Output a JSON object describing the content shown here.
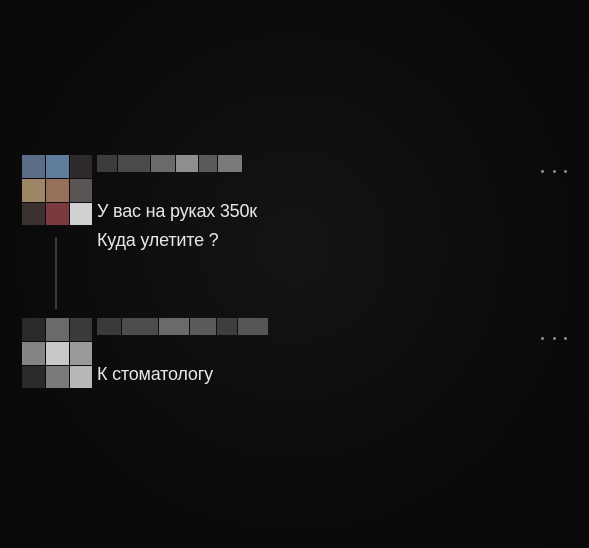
{
  "thread": {
    "posts": [
      {
        "lines": [
          "У вас на руках 350к",
          "Куда улетите ?"
        ],
        "avatar_colors": [
          "#5a6c86",
          "#5f7c9c",
          "#2e2a2c",
          "#9d8666",
          "#96705a",
          "#5a5454",
          "#3a3030",
          "#7a3a40",
          "#cfd1d3"
        ],
        "username_colors": [
          "#3c3c3c",
          "#4a4a4a",
          "#6a6a6a",
          "#8e8e8e",
          "#5a5a5a",
          "#7a7a7a"
        ]
      },
      {
        "lines": [
          "К стоматологу"
        ],
        "avatar_colors": [
          "#2a2a2a",
          "#6a6a6a",
          "#3a3a3a",
          "#858585",
          "#c8c8c8",
          "#9a9a9a",
          "#2a2a2a",
          "#7a7a7a",
          "#b8b8b8"
        ],
        "username_colors": [
          "#3a3a3a",
          "#4c4c4c",
          "#6a6a6a",
          "#5a5a5a",
          "#3e3e3e",
          "#555555"
        ]
      }
    ],
    "line_color": "#3a3a3a",
    "dots_color": "#8a8a8a"
  }
}
